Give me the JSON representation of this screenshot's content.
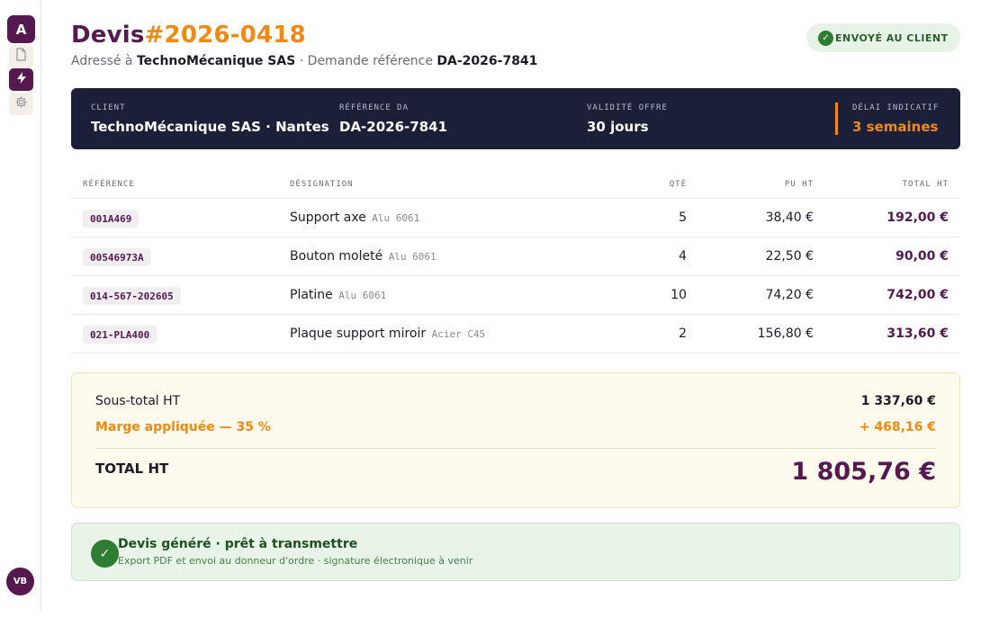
{
  "sidebar": {
    "logo_letter": "A",
    "items": [
      {
        "icon": "document-icon"
      },
      {
        "icon": "bolt-icon"
      },
      {
        "icon": "gear-icon"
      }
    ],
    "avatar_initials": "VB"
  },
  "header": {
    "title_prefix": "Devis",
    "quote_number": "#2026-0418",
    "subtitle_addressed": "Adressé à",
    "client_name": "TechnoMécanique SAS",
    "subtitle_request": "· Demande référence",
    "request_ref": "DA-2026-7841",
    "status_badge": "ENVOYÉ AU CLIENT"
  },
  "info": {
    "client_label": "CLIENT",
    "client_value": "TechnoMécanique SAS · Nantes",
    "ref_label": "RÉFÉRENCE DA",
    "ref_value": "DA-2026-7841",
    "validity_label": "VALIDITÉ OFFRE",
    "validity_value": "30 jours",
    "delay_label": "DÉLAI INDICATIF",
    "delay_value": "3 semaines"
  },
  "table": {
    "headers": {
      "ref": "RÉFÉRENCE",
      "designation": "DÉSIGNATION",
      "qty": "QTÉ",
      "unit_price": "PU HT",
      "total": "TOTAL HT"
    },
    "rows": [
      {
        "ref": "001A469",
        "designation": "Support axe",
        "material": "Alu 6061",
        "qty": "5",
        "unit_price": "38,40 €",
        "total": "192,00 €"
      },
      {
        "ref": "00546973A",
        "designation": "Bouton moleté",
        "material": "Alu 6061",
        "qty": "4",
        "unit_price": "22,50 €",
        "total": "90,00 €"
      },
      {
        "ref": "014-567-202605",
        "designation": "Platine",
        "material": "Alu 6061",
        "qty": "10",
        "unit_price": "74,20 €",
        "total": "742,00 €"
      },
      {
        "ref": "021-PLA400",
        "designation": "Plaque support miroir",
        "material": "Acier C45",
        "qty": "2",
        "unit_price": "156,80 €",
        "total": "313,60 €"
      }
    ]
  },
  "totals": {
    "subtotal_label": "Sous-total HT",
    "subtotal_value": "1 337,60 €",
    "margin_label": "Marge appliquée — 35 %",
    "margin_value": "+ 468,16 €",
    "total_label": "TOTAL HT",
    "total_value": "1 805,76 €"
  },
  "success": {
    "title": "Devis généré · prêt à transmettre",
    "detail": "Export PDF et envoi au donneur d'ordre · signature électronique à venir"
  },
  "colors": {
    "brand": "#55184f",
    "accent": "#ef8a14",
    "band": "#1c1f38",
    "success": "#2f7d32"
  }
}
